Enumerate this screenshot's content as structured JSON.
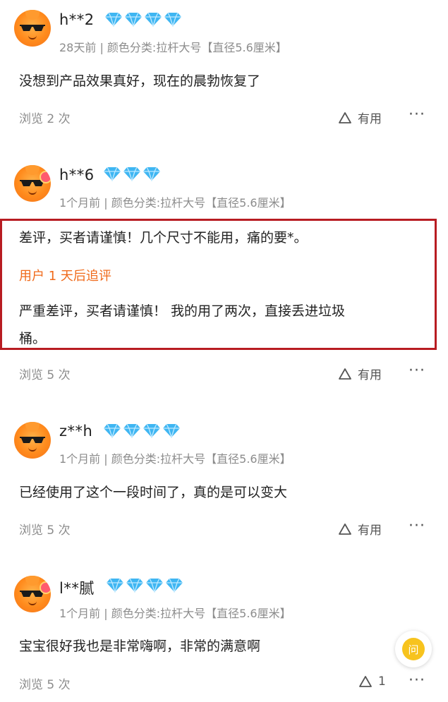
{
  "reviews": [
    {
      "username": "h**2",
      "diamond_count": 4,
      "meta": "28天前 | 颜色分类:拉杆大号【直径5.6厘米】",
      "text": "没想到产品效果真好，现在的晨勃恢复了",
      "views": "浏览 2 次",
      "useful": "有用",
      "more": "···"
    },
    {
      "username": "h**6",
      "diamond_count": 3,
      "meta": "1个月前 | 颜色分类:拉杆大号【直径5.6厘米】",
      "text": "差评，买者请谨慎！几个尺寸不能用，痛的要*。",
      "followup_label": "用户 1 天后追评",
      "followup_line1": "严重差评，买者请谨慎！ 我的用了两次，直接丢进垃圾",
      "followup_line2": "桶。",
      "views": "浏览 5 次",
      "useful": "有用",
      "more": "···"
    },
    {
      "username": "z**h",
      "diamond_count": 4,
      "meta": "1个月前 | 颜色分类:拉杆大号【直径5.6厘米】",
      "text": "已经使用了这个一段时间了，真的是可以变大",
      "views": "浏览 5 次",
      "useful": "有用",
      "more": "···"
    },
    {
      "username": "l**腻",
      "diamond_count": 4,
      "meta": "1个月前 | 颜色分类:拉杆大号【直径5.6厘米】",
      "text": "宝宝很好我也是非常嗨啊，非常的满意啊",
      "views": "浏览 5 次",
      "useful": "1",
      "more": "···"
    }
  ],
  "float_button": {
    "label": "问"
  },
  "colors": {
    "diamond": "#3fb6f2",
    "followup": "#f06a1a",
    "highlight_border": "#b81c22",
    "float_accent": "#f7c31d"
  }
}
